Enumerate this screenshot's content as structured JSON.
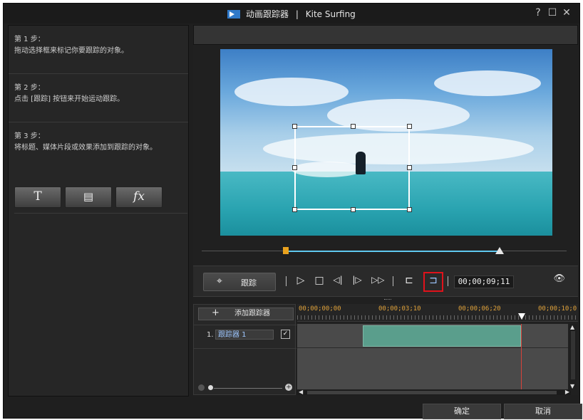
{
  "window": {
    "app_name": "动画跟踪器",
    "separator": "|",
    "project": "Kite Surfing",
    "help": "?",
    "maximize": "☐",
    "close": "✕"
  },
  "steps": [
    {
      "title": "第 1 步：",
      "desc": "拖动选择框来标记你要跟踪的对象。"
    },
    {
      "title": "第 2 步：",
      "desc": "点击 [跟踪] 按钮来开始运动跟踪。"
    },
    {
      "title": "第 3 步：",
      "desc": "将标题、媒体片段或效果添加到跟踪的对象。"
    }
  ],
  "tools": [
    {
      "name": "title-tool",
      "glyph": "T"
    },
    {
      "name": "media-tool",
      "glyph": "▤"
    },
    {
      "name": "effect-tool",
      "glyph": "fx"
    }
  ],
  "controls": {
    "track_label": "跟踪",
    "track_icon": "⌖",
    "play": "▷",
    "stop": "□",
    "prev_frame": "◁|",
    "next_frame": "|▷",
    "fast_forward": "▷▷",
    "set_start": "⊏",
    "set_end": "⊐",
    "timecode": "00;00;09;11",
    "eye": "👁"
  },
  "timeline": {
    "add_label": "添加跟踪器",
    "add_icon": "+",
    "ruler": [
      "00;00;00;00",
      "00;00;03;10",
      "00;00;06;20",
      "00;00;10;0"
    ],
    "tracks": [
      {
        "num": "1.",
        "name": "跟踪器 1",
        "checked": "✓"
      }
    ],
    "zoom_plus": "+"
  },
  "buttons": {
    "ok": "确定",
    "cancel": "取消"
  }
}
